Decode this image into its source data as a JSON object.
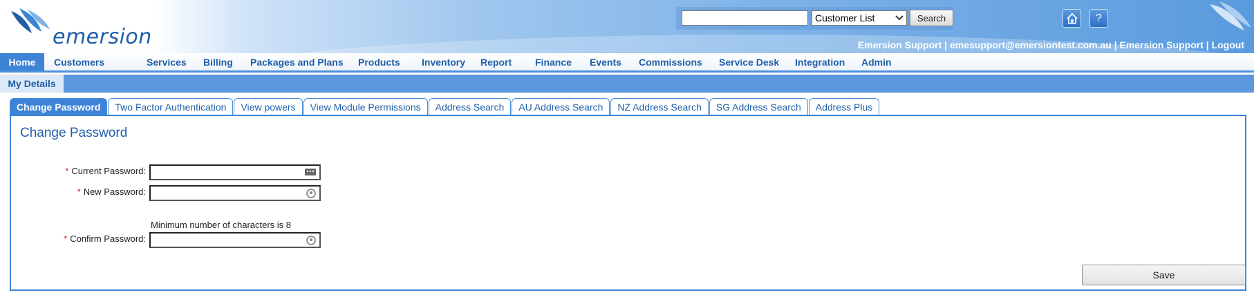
{
  "header": {
    "logo_text": "emersion",
    "search": {
      "value": "",
      "placeholder": "",
      "select_value": "Customer List",
      "button_label": "Search"
    },
    "user_bar": {
      "name": "Emersion Support",
      "email": "emesupport@emersiontest.com.au",
      "org": "Emersion Support",
      "logout": "Logout",
      "separator": "|"
    },
    "home_icon": "home-icon",
    "help_icon_label": "?"
  },
  "nav": {
    "items": [
      {
        "label": "Home"
      },
      {
        "label": "Customers"
      },
      {
        "label": "Services"
      },
      {
        "label": "Billing"
      },
      {
        "label": "Packages and Plans"
      },
      {
        "label": "Products"
      },
      {
        "label": "Inventory"
      },
      {
        "label": "Report"
      },
      {
        "label": "Finance"
      },
      {
        "label": "Events"
      },
      {
        "label": "Commissions"
      },
      {
        "label": "Service Desk"
      },
      {
        "label": "Integration"
      },
      {
        "label": "Admin"
      }
    ]
  },
  "subnav": {
    "items": [
      {
        "label": "My Details"
      }
    ]
  },
  "tabs": [
    {
      "label": "Change Password"
    },
    {
      "label": "Two Factor Authentication"
    },
    {
      "label": "View powers"
    },
    {
      "label": "View Module Permissions"
    },
    {
      "label": "Address Search"
    },
    {
      "label": "AU Address Search"
    },
    {
      "label": "NZ Address Search"
    },
    {
      "label": "SG Address Search"
    },
    {
      "label": "Address Plus"
    }
  ],
  "form": {
    "title": "Change Password",
    "required_mark": "*",
    "current_label": "Current Password:",
    "new_label": "New Password:",
    "confirm_label": "Confirm Password:",
    "hint": "Minimum number of characters is 8",
    "current_value": "",
    "new_value": "",
    "confirm_value": "",
    "save_label": "Save"
  },
  "colors": {
    "brand": "#1f5fa8",
    "accent": "#3d84d6",
    "required": "#dd2222"
  }
}
